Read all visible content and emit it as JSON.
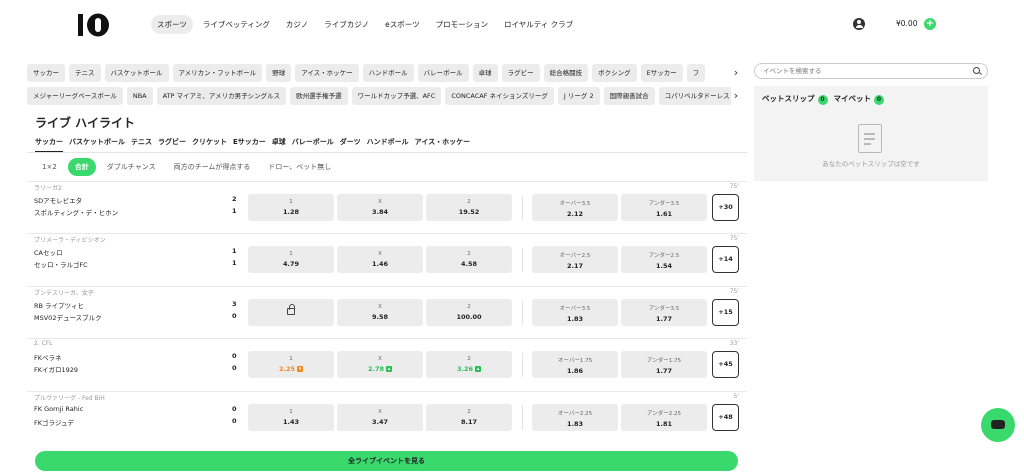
{
  "header": {
    "nav": [
      "スポーツ",
      "ライブベッティング",
      "カジノ",
      "ライブカジノ",
      "eスポーツ",
      "プロモーション",
      "ロイヤルティ クラブ"
    ],
    "balance": "¥0.00",
    "deposit": "+"
  },
  "sports_row1": [
    "サッカー",
    "テニス",
    "バスケットボール",
    "アメリカン・フットボール",
    "野球",
    "アイス・ホッケー",
    "ハンドボール",
    "バレーボール",
    "卓球",
    "ラグビー",
    "総合格闘技",
    "ボクシング",
    "Eサッカー",
    "フ"
  ],
  "sports_row2": [
    "メジャーリーグベースボール",
    "NBA",
    "ATP マイアミ、アメリカ男子シングルス",
    "欧州選手権予選",
    "ワールドカップ予選、AFC",
    "CONCACAF ネイションズリーグ",
    "J リーグ 2",
    "国際親善試合",
    "コパリベルタドーレス"
  ],
  "chip_arrow": "›",
  "main": {
    "title": "ライブ ハイライト",
    "sport_tabs": [
      "サッカー",
      "バスケットボール",
      "テニス",
      "ラグビー",
      "クリケット",
      "Eサッカー",
      "卓球",
      "バレーボール",
      "ダーツ",
      "ハンドボール",
      "アイス・ホッケー"
    ],
    "market_tabs": [
      "1×2",
      "合計",
      "ダブルチャンス",
      "両方のチームが得点する",
      "ドロー、ベット無し"
    ],
    "all_live_button": "全ライブイベントを見る"
  },
  "events": [
    {
      "league": "ラリーガ2",
      "time": "75'",
      "team1": "SDアモレビエタ",
      "team2": "スポルティング・デ・ヒホン",
      "score1": "2",
      "score2": "1",
      "odd1": {
        "label": "1",
        "value": "1.28"
      },
      "oddx": {
        "label": "X",
        "value": "3.84"
      },
      "odd2": {
        "label": "2",
        "value": "19.52"
      },
      "over": {
        "label": "オーバー3.5",
        "value": "2.12"
      },
      "under": {
        "label": "アンダー3.5",
        "value": "1.61"
      },
      "more": "+30"
    },
    {
      "league": "プリメーラ・ディビシオン",
      "time": "75'",
      "team1": "CAセッロ",
      "team2": "セッロ・ラルゴFC",
      "score1": "1",
      "score2": "1",
      "odd1": {
        "label": "1",
        "value": "4.79"
      },
      "oddx": {
        "label": "X",
        "value": "1.46"
      },
      "odd2": {
        "label": "2",
        "value": "4.58"
      },
      "over": {
        "label": "オーバー2.5",
        "value": "2.17"
      },
      "under": {
        "label": "アンダー2.5",
        "value": "1.54"
      },
      "more": "+14"
    },
    {
      "league": "ブンデスリーガ、女子",
      "time": "75'",
      "team1": "RB ライプツィヒ",
      "team2": "MSV02デュースブルク",
      "score1": "3",
      "score2": "0",
      "odd1": {
        "label": "",
        "value": ""
      },
      "oddx": {
        "label": "X",
        "value": "9.58"
      },
      "odd2": {
        "label": "2",
        "value": "100.00"
      },
      "over": {
        "label": "オーバー3.5",
        "value": "1.83"
      },
      "under": {
        "label": "アンダー3.5",
        "value": "1.77"
      },
      "more": "+15"
    },
    {
      "league": "2. CFL",
      "time": "33'",
      "team1": "FKペラネ",
      "team2": "FKイガロ1929",
      "score1": "0",
      "score2": "0",
      "odd1": {
        "label": "1",
        "value": "2.25"
      },
      "oddx": {
        "label": "X",
        "value": "2.78"
      },
      "odd2": {
        "label": "2",
        "value": "3.26"
      },
      "over": {
        "label": "オーバー1.75",
        "value": "1.86"
      },
      "under": {
        "label": "アンダー1.75",
        "value": "1.77"
      },
      "more": "+45"
    },
    {
      "league": "プルヴァリーグ - Fed BiH",
      "time": "5'",
      "team1": "FK Gornji Rahic",
      "team2": "FKゴラジュデ",
      "score1": "0",
      "score2": "0",
      "odd1": {
        "label": "1",
        "value": "1.43"
      },
      "oddx": {
        "label": "X",
        "value": "3.47"
      },
      "odd2": {
        "label": "2",
        "value": "8.17"
      },
      "over": {
        "label": "オーバー2.25",
        "value": "1.83"
      },
      "under": {
        "label": "アンダー2.25",
        "value": "1.81"
      },
      "more": "+48"
    }
  ],
  "sidebar": {
    "search_placeholder": "イベントを検索する",
    "betslip_label": "ベットスリップ",
    "betslip_count": "0",
    "mybets_label": "マイベット",
    "mybets_count": "0",
    "empty_text": "あなたのベットスリップは空です"
  },
  "colors": {
    "accent": "#3ad96d",
    "odds_down": "#f08a1c",
    "odds_up": "#2ebc58"
  }
}
